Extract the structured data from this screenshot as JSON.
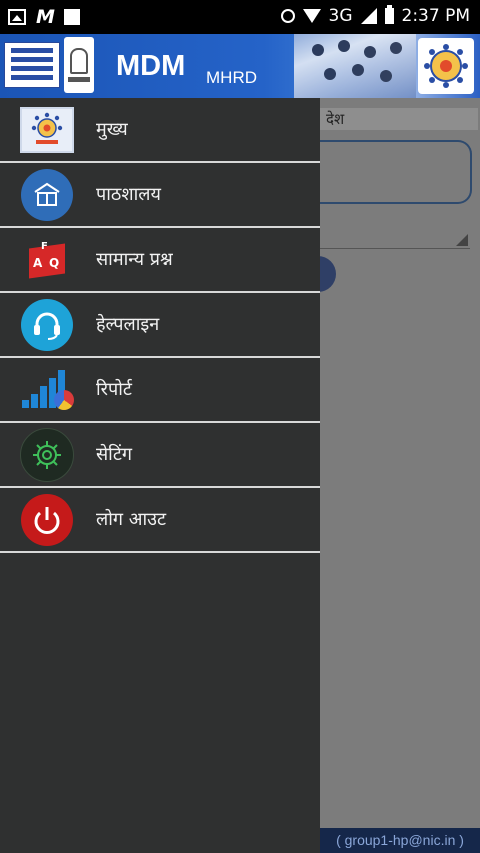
{
  "status_bar": {
    "network": "3G",
    "time": "2:37 PM",
    "left_icons": [
      "image-icon",
      "gmail-icon",
      "notification-square-icon"
    ],
    "right_icons": [
      "alarm-icon",
      "wifi-icon",
      "signal-icon",
      "battery-icon"
    ]
  },
  "header": {
    "title": "MDM",
    "subtitle": "MHRD",
    "menu_icon": "hamburger-menu-icon",
    "colors": {
      "bar": "#2563c8",
      "hamburger_lines": "#2a4ea5"
    }
  },
  "drawer": {
    "items": [
      {
        "label": "मुख्य",
        "icon": "mdm-logo-icon"
      },
      {
        "label": "पाठशालय",
        "icon": "school-book-icon"
      },
      {
        "label": "सामान्य प्रश्न",
        "icon": "faq-cube-icon"
      },
      {
        "label": "हेल्पलाइन",
        "icon": "headset-icon"
      },
      {
        "label": "रिपोर्ट",
        "icon": "bar-chart-icon"
      },
      {
        "label": "सेटिंग",
        "icon": "gear-icon"
      },
      {
        "label": "लोग आउट",
        "icon": "power-icon"
      }
    ],
    "colors": {
      "background": "#2f3030",
      "divider": "#d8d8d8",
      "text": "#f2f2f2"
    }
  },
  "background_page": {
    "partial_heading": "देश",
    "footer_text": "( group1-hp@nic.in )"
  }
}
